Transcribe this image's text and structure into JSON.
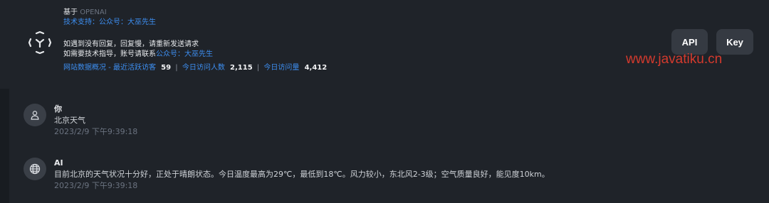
{
  "header": {
    "line1_prefix": "基于",
    "line1_model": "OPENAI",
    "line2": "技术支持：公众号：大巫先生",
    "line3": "如遇到没有回复，回复慢，请重新发送请求",
    "line4_prefix": "如需要技术指导，账号请联系",
    "line4_link": "公众号：大巫先生",
    "stats": {
      "label": "网站数据概况 - 最近活跃访客",
      "active_visitors": "59",
      "today_users_label": "今日访问人数",
      "today_users": "2,115",
      "today_visits_label": "今日访问量",
      "today_visits": "4,412"
    }
  },
  "buttons": {
    "api": "API",
    "key": "Key"
  },
  "watermark": "www.javatiku.cn",
  "messages": [
    {
      "name": "你",
      "text": "北京天气",
      "time": "2023/2/9 下午9:39:18",
      "avatar_icon": "user-icon"
    },
    {
      "name": "AI",
      "text": "目前北京的天气状况十分好，正处于晴朗状态。今日温度最高为29℃，最低到18℃。风力较小，东北风2-3级；空气质量良好，能见度10km。",
      "time": "2023/2/9 下午9:39:18",
      "avatar_icon": "globe-icon"
    }
  ],
  "colors": {
    "background": "#1f2329",
    "link": "#3d8ef0",
    "button": "#353a42",
    "watermark": "#d43a2d"
  }
}
